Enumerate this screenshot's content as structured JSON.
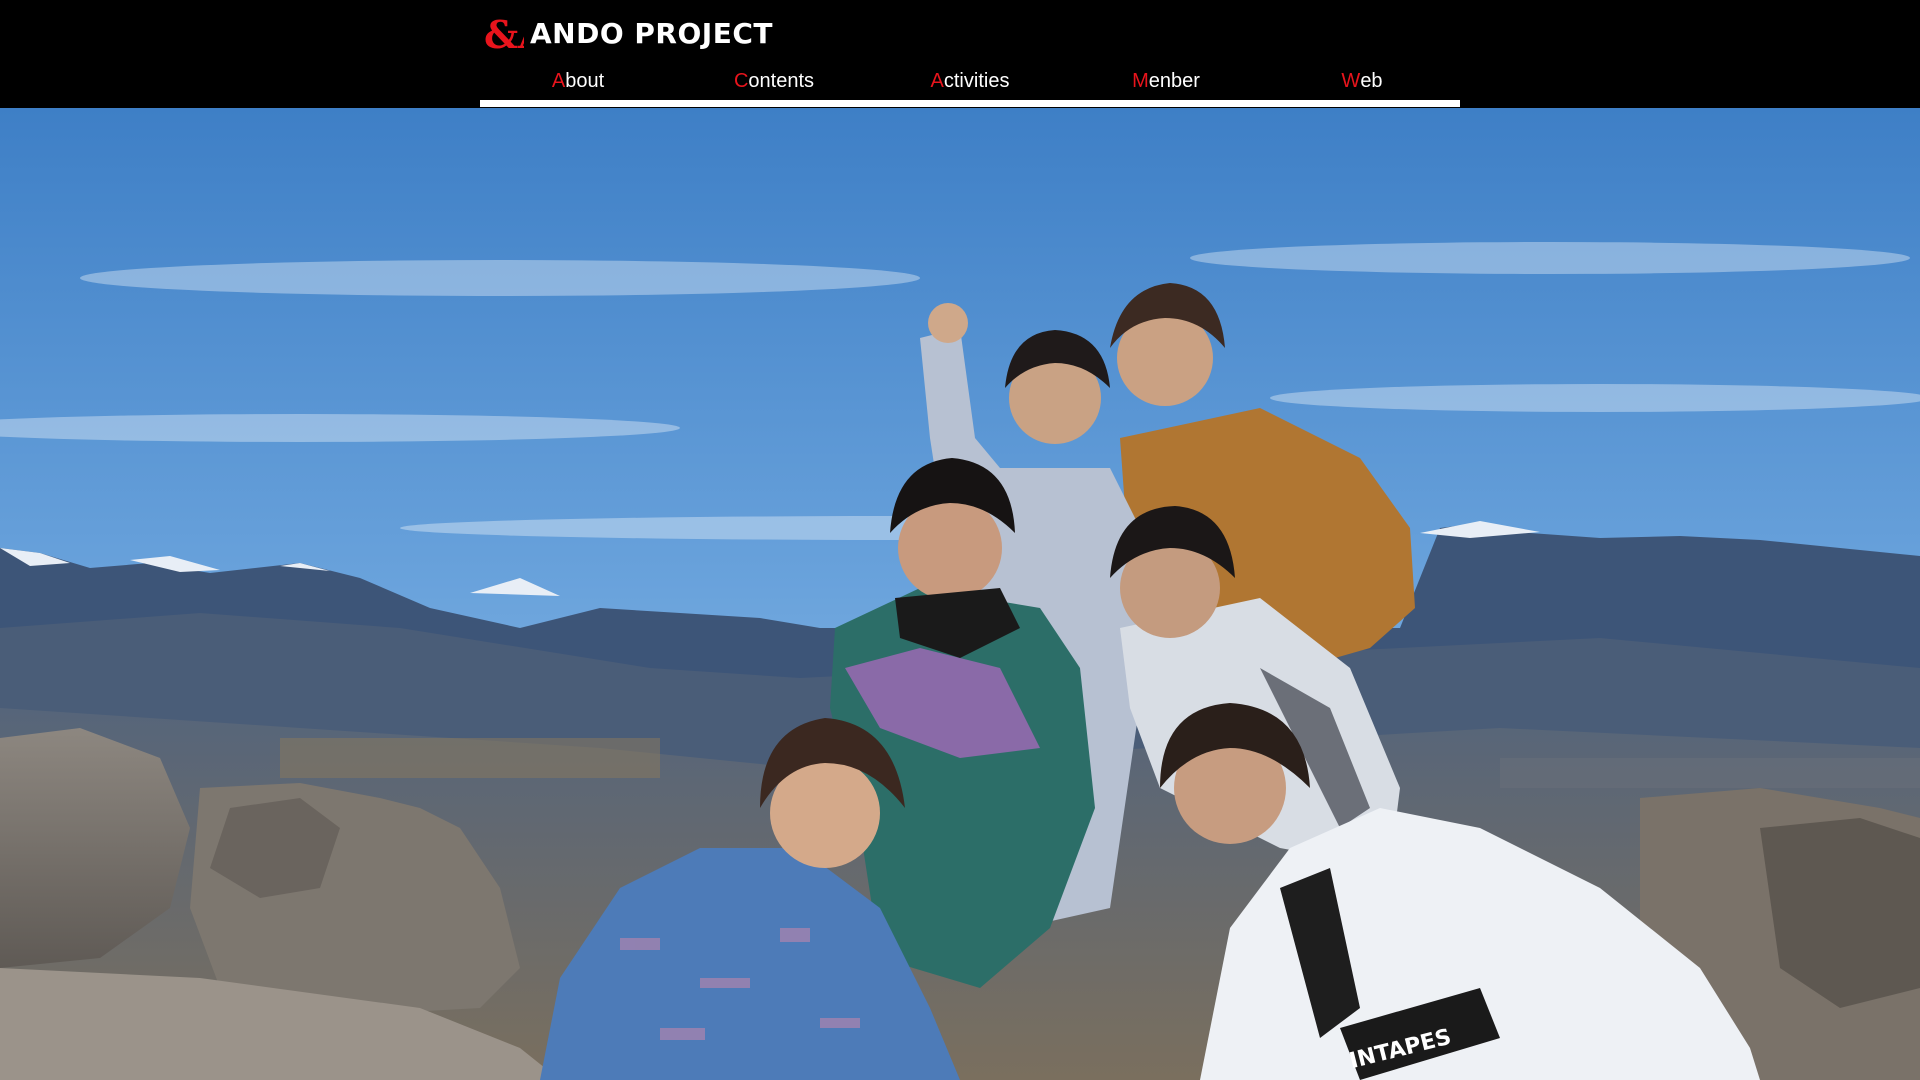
{
  "site": {
    "logo_mark": "&A",
    "logo_text": "ANDO PROJECT"
  },
  "nav": {
    "items": [
      {
        "first": "A",
        "rest": "bout"
      },
      {
        "first": "C",
        "rest": "ontents"
      },
      {
        "first": "A",
        "rest": "ctivities"
      },
      {
        "first": "M",
        "rest": "enber"
      },
      {
        "first": "W",
        "rest": "eb"
      }
    ]
  },
  "colors": {
    "header_bg": "#000000",
    "nav_accent": "#e8141c",
    "nav_text": "#ffffff"
  },
  "hero": {
    "image_description_icon": "group-photo-mountain-summit",
    "jacket_text": "INTAPES"
  }
}
